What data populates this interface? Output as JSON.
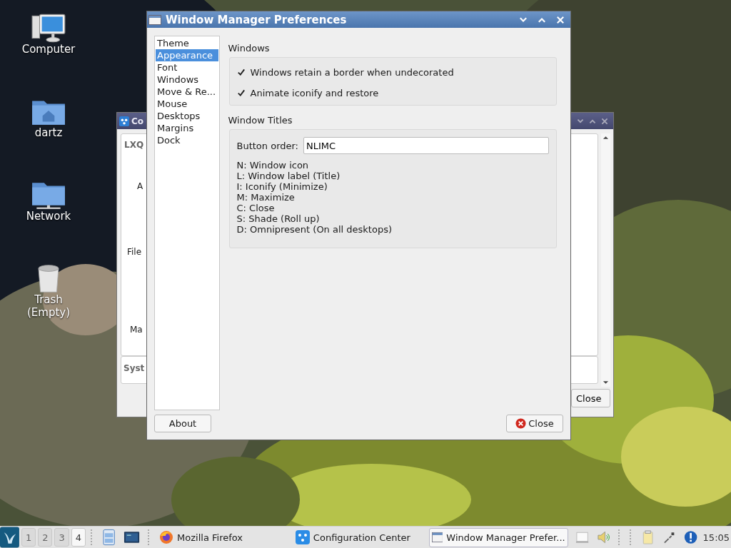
{
  "desktop_icons": [
    {
      "label": "Computer",
      "kind": "computer"
    },
    {
      "label": "dartz",
      "kind": "home"
    },
    {
      "label": "Network",
      "kind": "network"
    },
    {
      "label": "Trash (Empty)",
      "kind": "trash"
    }
  ],
  "background_window": {
    "title": "Co",
    "panels": [
      "LXQ",
      "Syst"
    ],
    "labels": [
      "A",
      "File",
      "Ma"
    ],
    "close_button": "Close"
  },
  "window": {
    "title": "Window Manager Preferences",
    "sidebar": [
      {
        "label": "Theme",
        "selected": false
      },
      {
        "label": "Appearance",
        "selected": true
      },
      {
        "label": "Font",
        "selected": false
      },
      {
        "label": "Windows",
        "selected": false
      },
      {
        "label": "Move & Re...",
        "selected": false
      },
      {
        "label": "Mouse",
        "selected": false
      },
      {
        "label": "Desktops",
        "selected": false
      },
      {
        "label": "Margins",
        "selected": false
      },
      {
        "label": "Dock",
        "selected": false
      }
    ],
    "windows_section": {
      "title": "Windows",
      "checkboxes": [
        {
          "label": "Windows retain a border when undecorated",
          "checked": true
        },
        {
          "label": "Animate iconify and restore",
          "checked": true
        }
      ]
    },
    "titles_section": {
      "title": "Window Titles",
      "button_order": {
        "label": "Button order:",
        "value": "NLIMC"
      },
      "legend": [
        "N: Window icon",
        "L: Window label (Title)",
        "I: Iconify (Minimize)",
        "M: Maximize",
        "C: Close",
        "S: Shade (Roll up)",
        "D: Omnipresent (On all desktops)"
      ]
    },
    "about_button": "About",
    "close_button": "Close"
  },
  "taskbar": {
    "desktops": [
      {
        "label": "1",
        "selected": false
      },
      {
        "label": "2",
        "selected": false
      },
      {
        "label": "3",
        "selected": false
      },
      {
        "label": "4",
        "selected": true
      }
    ],
    "tasks": [
      {
        "label": "Mozilla Firefox",
        "kind": "firefox",
        "selected": false
      },
      {
        "label": "Configuration Center",
        "kind": "config",
        "selected": false
      },
      {
        "label": "Window Manager Prefer...",
        "kind": "window",
        "selected": true
      }
    ],
    "clock": "15:05"
  }
}
